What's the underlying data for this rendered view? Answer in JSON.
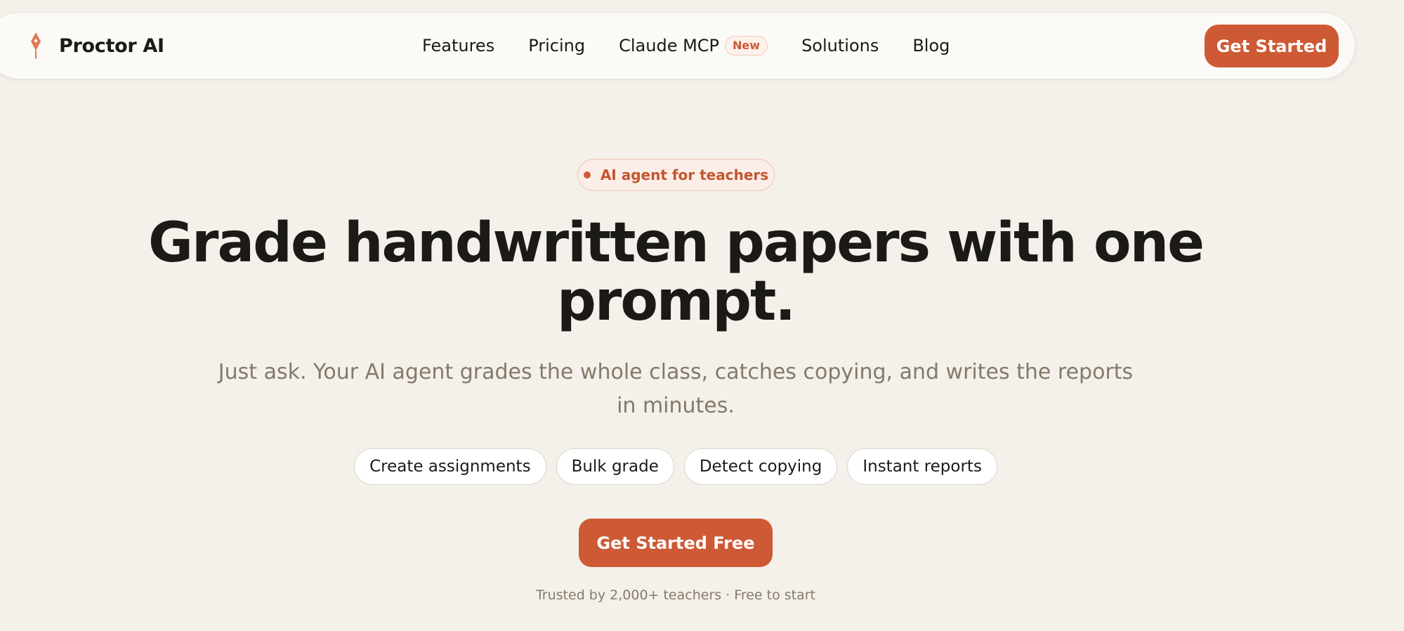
{
  "nav": {
    "brand": "Proctor AI",
    "brand_icon": "pen-nib-icon",
    "links": [
      "Features",
      "Pricing",
      "Claude MCP",
      "Solutions",
      "Blog"
    ],
    "new_badge": "New",
    "cta": "Get Started"
  },
  "hero": {
    "pill": "AI agent for teachers",
    "headline": "Grade handwritten papers with one prompt.",
    "subheadline": "Just ask. Your AI agent grades the whole class, catches copying, and writes the reports in minutes.",
    "chips": [
      "Create assignments",
      "Bulk grade",
      "Detect copying",
      "Instant reports"
    ],
    "cta": "Get Started Free",
    "trust": "Trusted by 2,000+ teachers · Free to start"
  },
  "colors": {
    "accent": "#cd5a35",
    "background": "#f4f1eb",
    "text": "#1c1a17",
    "muted": "#857969"
  }
}
